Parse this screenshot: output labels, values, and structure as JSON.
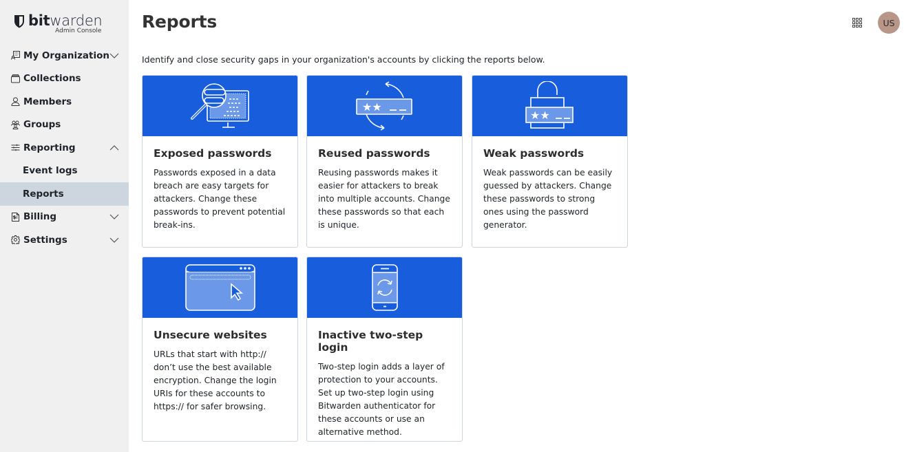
{
  "app": {
    "brand_bold": "bit",
    "brand_light": "warden",
    "subtitle": "Admin Console"
  },
  "sidebar": {
    "items": [
      {
        "label": "My Organization",
        "icon": "organization-icon",
        "chevron": "down"
      },
      {
        "label": "Collections",
        "icon": "collection-icon"
      },
      {
        "label": "Members",
        "icon": "user-icon"
      },
      {
        "label": "Groups",
        "icon": "groups-icon"
      },
      {
        "label": "Reporting",
        "icon": "sliders-icon",
        "chevron": "up"
      },
      {
        "label": "Event logs",
        "sub": true
      },
      {
        "label": "Reports",
        "sub": true,
        "active": true
      },
      {
        "label": "Billing",
        "icon": "billing-icon",
        "chevron": "down"
      },
      {
        "label": "Settings",
        "icon": "gear-icon",
        "chevron": "down"
      }
    ]
  },
  "header": {
    "title": "Reports",
    "avatar_initials": "US",
    "avatar_color": "#b99788"
  },
  "intro": "Identify and close security gaps in your organization's accounts by clicking the reports below.",
  "colors": {
    "banner": "#175ddc",
    "active_nav": "#cdd5df",
    "sidebar_bg": "#f0f0f0"
  },
  "reports": [
    {
      "title": "Exposed passwords",
      "icon": "magnifier-monitor-icon",
      "description": "Passwords exposed in a data breach are easy targets for attackers. Change these passwords to prevent potential break-ins."
    },
    {
      "title": "Reused passwords",
      "icon": "password-cycle-icon",
      "description": "Reusing passwords makes it easier for attackers to break into multiple accounts. Change these passwords so that each is unique."
    },
    {
      "title": "Weak passwords",
      "icon": "unlocked-padlock-icon",
      "description": "Weak passwords can be easily guessed by attackers. Change these passwords to strong ones using the password generator."
    },
    {
      "title": "Unsecure websites",
      "icon": "browser-cursor-icon",
      "description": "URLs that start with http:// don’t use the best available encryption. Change the login URIs for these accounts to https:// for safer browsing."
    },
    {
      "title": "Inactive two-step login",
      "icon": "phone-sync-icon",
      "description": "Two-step login adds a layer of protection to your accounts. Set up two-step login using Bitwarden authenticator for these accounts or use an alternative method."
    }
  ]
}
